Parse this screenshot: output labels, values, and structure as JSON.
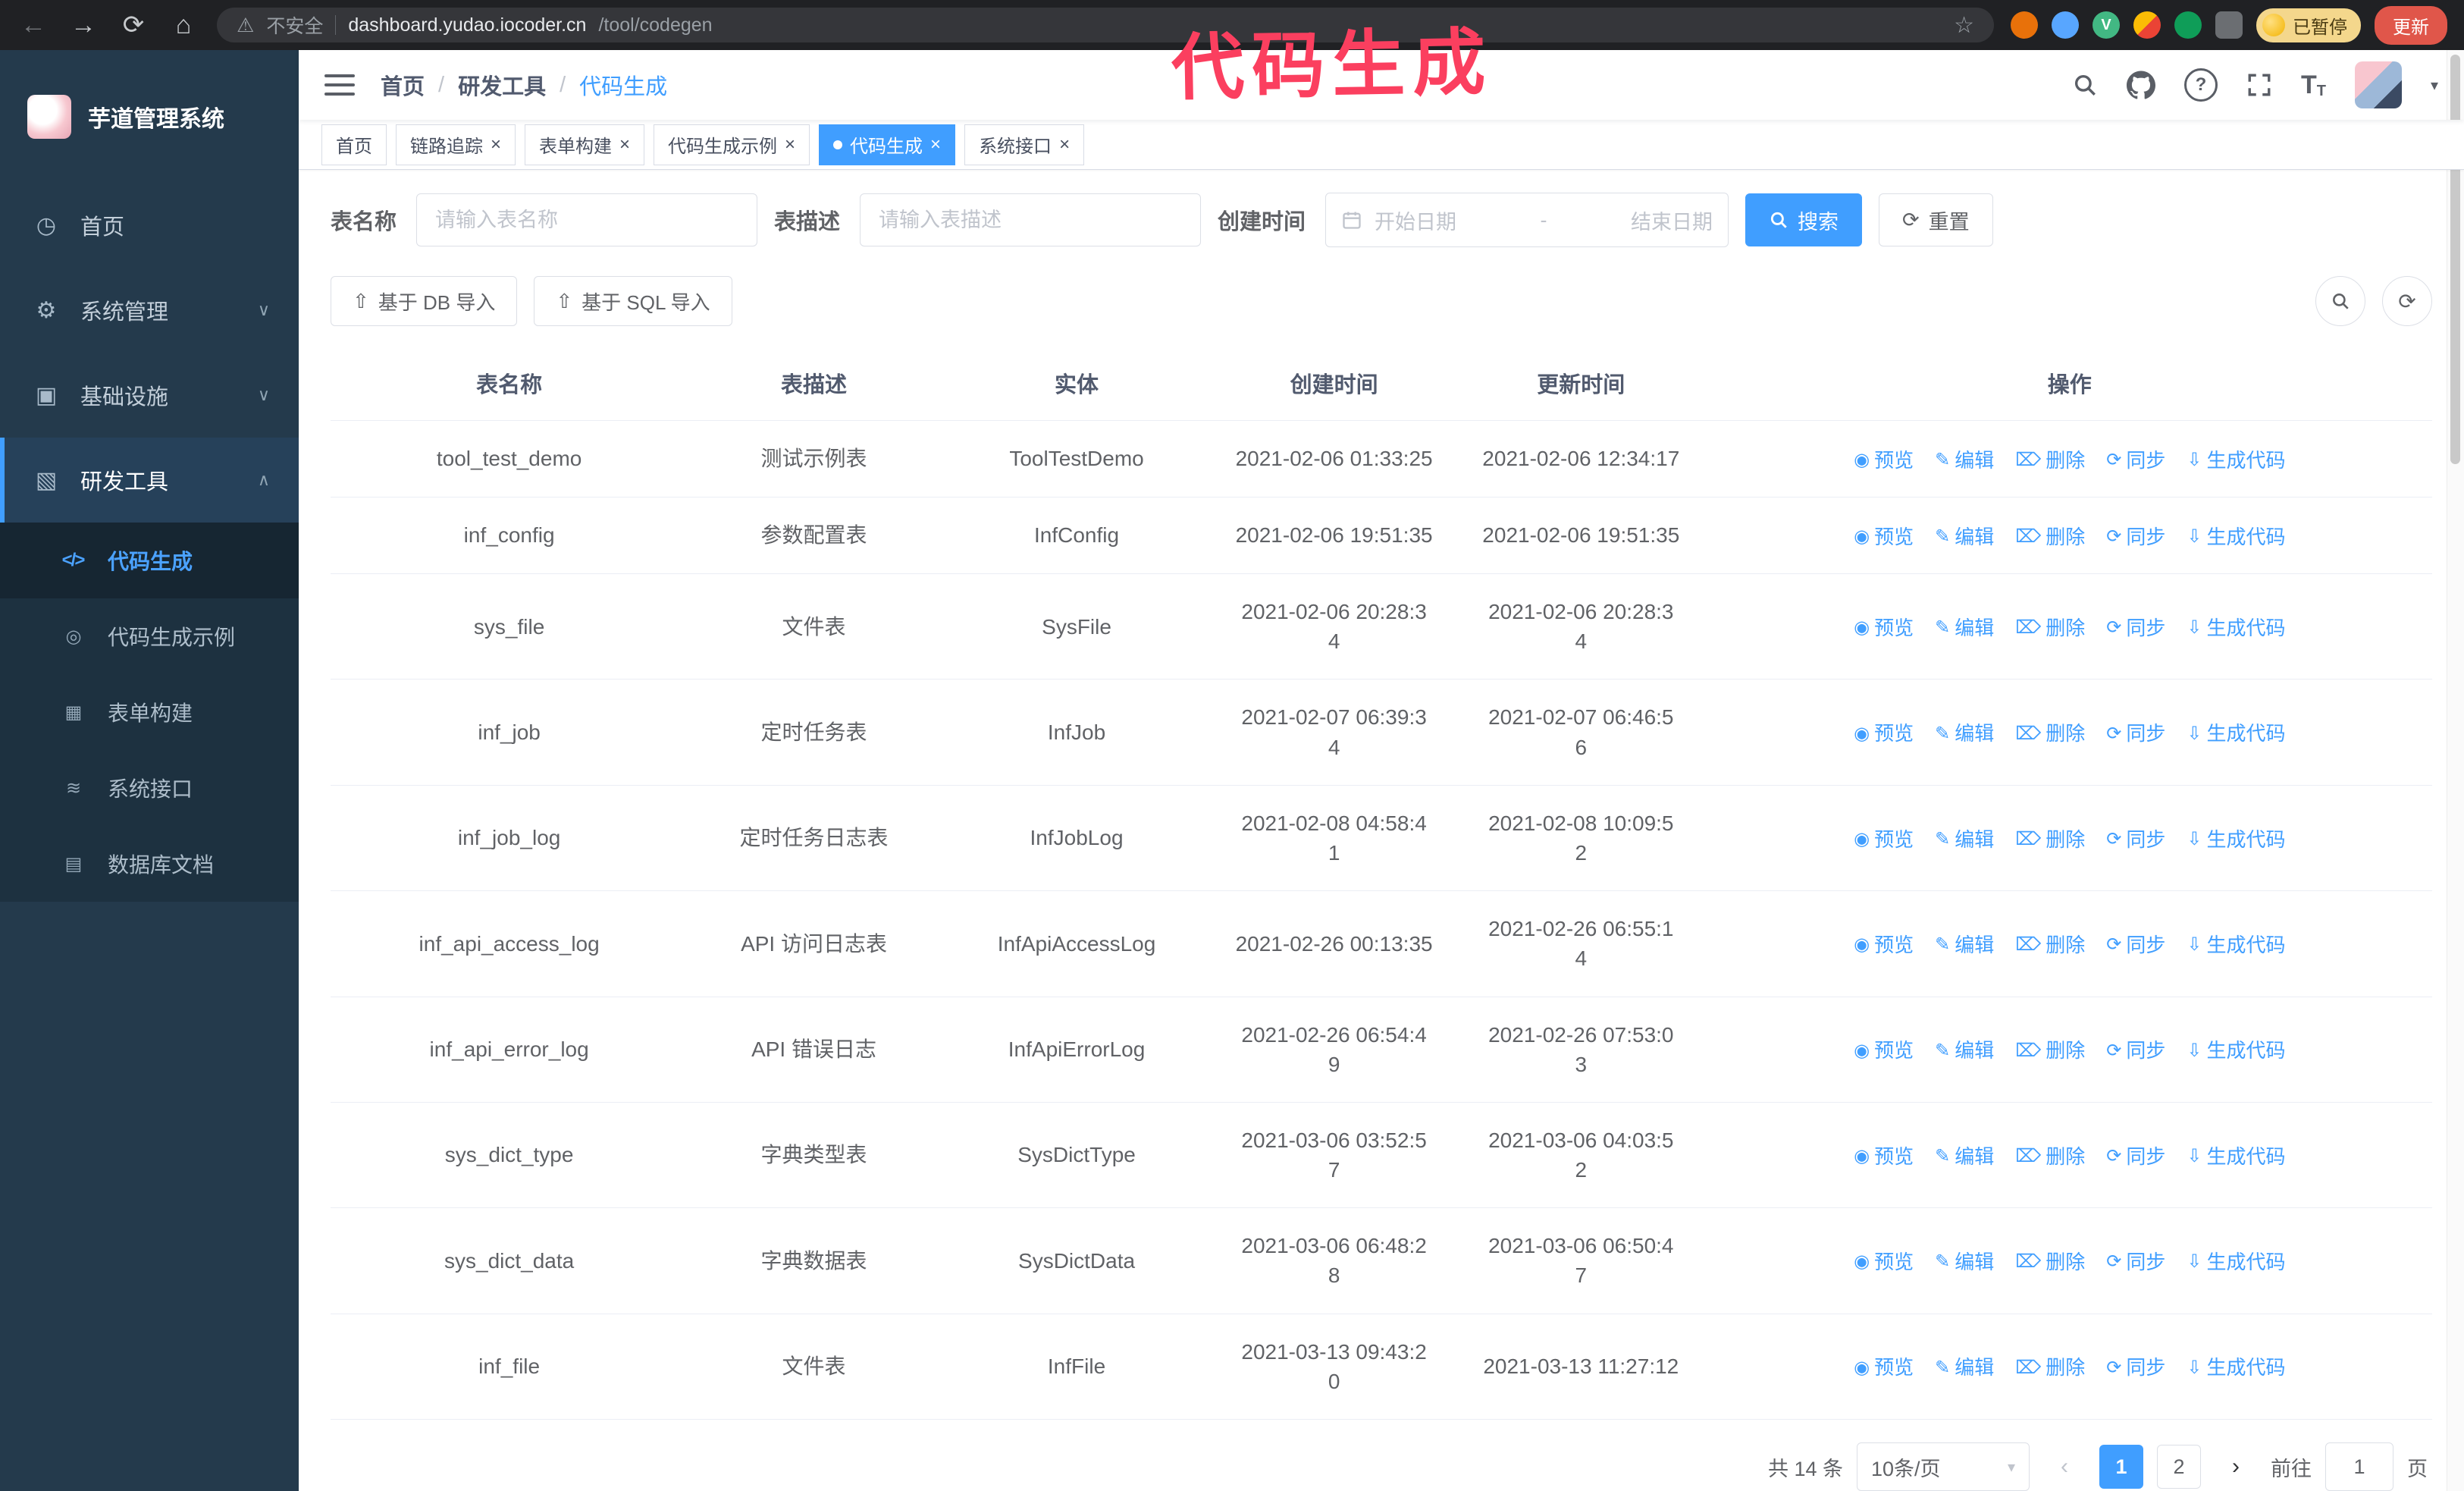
{
  "browser": {
    "security_label": "不安全",
    "url_host": "dashboard.yudao.iocoder.cn",
    "url_path": "/tool/codegen",
    "paused_badge": "已暂停",
    "update_button": "更新"
  },
  "annotation": {
    "text": "代码生成",
    "color": "#fb3f5f"
  },
  "glyphs": {
    "back": "←",
    "forward": "→",
    "reload": "⟳",
    "home": "⌂",
    "warning": "⚠",
    "star": "☆",
    "vue_v": "V",
    "separator": "/",
    "chevron_down": "∨",
    "chevron_up": "∧",
    "caret_down": "▾",
    "close": "×",
    "question": "?",
    "font_size": "T",
    "range_dash": "-",
    "refresh": "⟳",
    "upload": "⇧",
    "prev": "‹",
    "next": "›"
  },
  "icons": {
    "home": "◷",
    "system": "⚙",
    "infra": "▣",
    "devtools": "▧",
    "codegen": "</>",
    "codegen_demo": "◎",
    "form_builder": "▦",
    "api": "≋",
    "db_doc": "▤"
  },
  "sidebar": {
    "title": "芋道管理系统",
    "items": [
      {
        "label": "首页"
      },
      {
        "label": "系统管理"
      },
      {
        "label": "基础设施"
      },
      {
        "label": "研发工具"
      }
    ],
    "subitems": [
      {
        "label": "代码生成"
      },
      {
        "label": "代码生成示例"
      },
      {
        "label": "表单构建"
      },
      {
        "label": "系统接口"
      },
      {
        "label": "数据库文档"
      }
    ]
  },
  "header": {
    "breadcrumb": [
      "首页",
      "研发工具",
      "代码生成"
    ]
  },
  "tabs": [
    {
      "label": "首页",
      "closable": false
    },
    {
      "label": "链路追踪",
      "closable": true
    },
    {
      "label": "表单构建",
      "closable": true
    },
    {
      "label": "代码生成示例",
      "closable": true
    },
    {
      "label": "代码生成",
      "closable": true,
      "active": true
    },
    {
      "label": "系统接口",
      "closable": true
    }
  ],
  "filters": {
    "name_label": "表名称",
    "name_placeholder": "请输入表名称",
    "desc_label": "表描述",
    "desc_placeholder": "请输入表描述",
    "time_label": "创建时间",
    "start_placeholder": "开始日期",
    "end_placeholder": "结束日期",
    "search_button": "搜索",
    "reset_button": "重置"
  },
  "toolbar": {
    "import_db": "基于 DB 导入",
    "import_sql": "基于 SQL 导入"
  },
  "table": {
    "columns": [
      "表名称",
      "表描述",
      "实体",
      "创建时间",
      "更新时间",
      "操作"
    ],
    "actions": [
      {
        "id": "preview",
        "label": "预览",
        "icon": "◉"
      },
      {
        "id": "edit",
        "label": "编辑",
        "icon": "✎"
      },
      {
        "id": "delete",
        "label": "删除",
        "icon": "⌦"
      },
      {
        "id": "sync",
        "label": "同步",
        "icon": "⟳"
      },
      {
        "id": "generate",
        "label": "生成代码",
        "icon": "⇩"
      }
    ],
    "rows": [
      {
        "name": "tool_test_demo",
        "desc": "测试示例表",
        "entity": "ToolTestDemo",
        "created": "2021-02-06 01:33:25",
        "updated": "2021-02-06 12:34:17"
      },
      {
        "name": "inf_config",
        "desc": "参数配置表",
        "entity": "InfConfig",
        "created": "2021-02-06 19:51:35",
        "updated": "2021-02-06 19:51:35"
      },
      {
        "name": "sys_file",
        "desc": "文件表",
        "entity": "SysFile",
        "created": "2021-02-06 20:28:3\n4",
        "updated": "2021-02-06 20:28:3\n4"
      },
      {
        "name": "inf_job",
        "desc": "定时任务表",
        "entity": "InfJob",
        "created": "2021-02-07 06:39:3\n4",
        "updated": "2021-02-07 06:46:5\n6"
      },
      {
        "name": "inf_job_log",
        "desc": "定时任务日志表",
        "entity": "InfJobLog",
        "created": "2021-02-08 04:58:4\n1",
        "updated": "2021-02-08 10:09:5\n2"
      },
      {
        "name": "inf_api_access_log",
        "desc": "API 访问日志表",
        "entity": "InfApiAccessLog",
        "created": "2021-02-26 00:13:35",
        "updated": "2021-02-26 06:55:1\n4"
      },
      {
        "name": "inf_api_error_log",
        "desc": "API 错误日志",
        "entity": "InfApiErrorLog",
        "created": "2021-02-26 06:54:4\n9",
        "updated": "2021-02-26 07:53:0\n3"
      },
      {
        "name": "sys_dict_type",
        "desc": "字典类型表",
        "entity": "SysDictType",
        "created": "2021-03-06 03:52:5\n7",
        "updated": "2021-03-06 04:03:5\n2"
      },
      {
        "name": "sys_dict_data",
        "desc": "字典数据表",
        "entity": "SysDictData",
        "created": "2021-03-06 06:48:2\n8",
        "updated": "2021-03-06 06:50:4\n7"
      },
      {
        "name": "inf_file",
        "desc": "文件表",
        "entity": "InfFile",
        "created": "2021-03-13 09:43:2\n0",
        "updated": "2021-03-13 11:27:12"
      }
    ]
  },
  "pagination": {
    "total": "共 14 条",
    "page_size": "10条/页",
    "pages": [
      "1",
      "2"
    ],
    "active_page": "1",
    "goto_label": "前往",
    "goto_value": "1",
    "goto_suffix": "页"
  }
}
